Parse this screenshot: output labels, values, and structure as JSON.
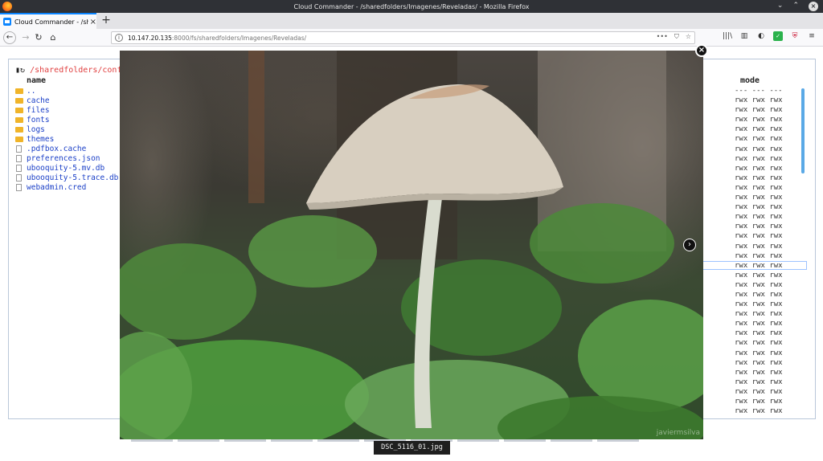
{
  "window": {
    "title": "Cloud Commander - /sharedfolders/Imagenes/Reveladas/ - Mozilla Firefox"
  },
  "tab": {
    "title": "Cloud Commander - /share",
    "close": "×",
    "new_tab": "+"
  },
  "nav": {
    "back": "←",
    "forward": "→",
    "reload": "↻",
    "home": "⌂"
  },
  "urlbar": {
    "host": "10.147.20.135",
    "rest": ":8000/fs/sharedfolders/Imagenes/Reveladas/",
    "more": "•••",
    "pocket": "⛉",
    "bookmark": "☆"
  },
  "toolbar": {
    "library": "|||\\",
    "sidebar": "▥",
    "account": "◐",
    "ext_green": "✓",
    "ext_red": "⛨",
    "menu": "≡"
  },
  "filemanager": {
    "path": "/sharedfolders/confi",
    "col_name": "name",
    "col_mode": "mode",
    "entries": [
      {
        "name": "..",
        "type": "folder"
      },
      {
        "name": "cache",
        "type": "folder"
      },
      {
        "name": "files",
        "type": "folder"
      },
      {
        "name": "fonts",
        "type": "folder"
      },
      {
        "name": "logs",
        "type": "folder"
      },
      {
        "name": "themes",
        "type": "folder"
      },
      {
        "name": ".pdfbox.cache",
        "type": "file"
      },
      {
        "name": "preferences.json",
        "type": "file"
      },
      {
        "name": "ubooquity-5.mv.db",
        "type": "file"
      },
      {
        "name": "ubooquity-5.trace.db",
        "type": "file"
      },
      {
        "name": "webadmin.cred",
        "type": "file"
      }
    ],
    "modes": [
      "--- --- ---",
      "rwx rwx rwx",
      "rwx rwx rwx",
      "rwx rwx rwx",
      "rwx rwx rwx",
      "rwx rwx rwx",
      "rwx rwx rwx",
      "rwx rwx rwx",
      "rwx rwx rwx",
      "rwx rwx rwx",
      "rwx rwx rwx",
      "rwx rwx rwx",
      "rwx rwx rwx",
      "rwx rwx rwx",
      "rwx rwx rwx",
      "rwx rwx rwx",
      "rwx rwx rwx",
      "rwx rwx rwx",
      "rwx rwx rwx",
      "rwx rwx rwx",
      "rwx rwx rwx",
      "rwx rwx rwx",
      "rwx rwx rwx",
      "rwx rwx rwx",
      "rwx rwx rwx",
      "rwx rwx rwx",
      "rwx rwx rwx",
      "rwx rwx rwx",
      "rwx rwx rwx",
      "rwx rwx rwx",
      "rwx rwx rwx",
      "rwx rwx rwx",
      "rwx rwx rwx",
      "rwx rwx rwx"
    ]
  },
  "viewer": {
    "close": "×",
    "next": "›",
    "watermark": "javiermsilva",
    "caption": "DSC_5116_01.jpg"
  },
  "colors": {
    "accent": "#0a84ff",
    "path_red": "#e04040",
    "link_blue": "#1a3fc7",
    "folder": "#f0b429"
  }
}
